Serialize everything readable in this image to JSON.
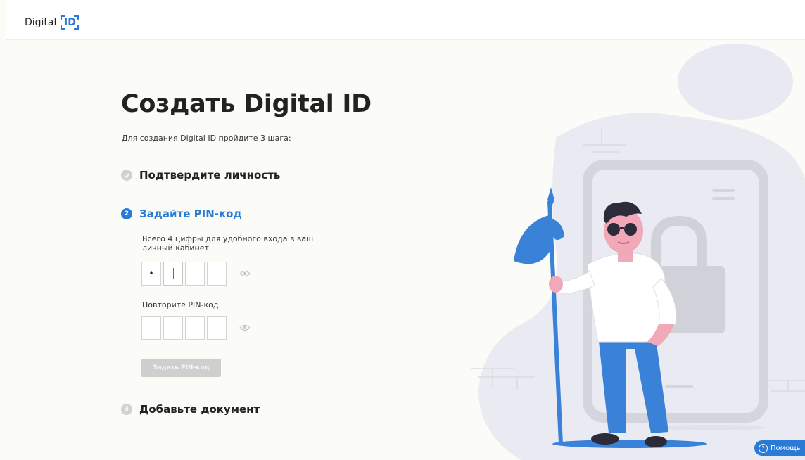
{
  "header": {
    "logo_text": "Digital",
    "logo_id": "ID"
  },
  "main": {
    "title": "Создать Digital ID",
    "subtitle": "Для создания Digital ID пройдите 3 шага:",
    "steps": [
      {
        "number": "✓",
        "label": "Подтвердите личность",
        "state": "done"
      },
      {
        "number": "2",
        "label": "Задайте PIN-код",
        "state": "active"
      },
      {
        "number": "3",
        "label": "Добавьте документ",
        "state": "pending"
      }
    ],
    "pin": {
      "hint": "Всего 4 цифры для удобного входа в ваш личный кабинет",
      "first_cells": [
        "•",
        "",
        "",
        ""
      ],
      "repeat_label": "Повторите PIN-код",
      "repeat_cells": [
        "",
        "",
        "",
        ""
      ],
      "submit_label": "Задать PIN-код"
    }
  },
  "help": {
    "label": "Помощь"
  },
  "colors": {
    "accent": "#2a7bd6",
    "disabled": "#cfcfcf",
    "background": "#fbfbf8"
  },
  "icons": {
    "eye": "eye-icon",
    "help": "question-icon"
  }
}
